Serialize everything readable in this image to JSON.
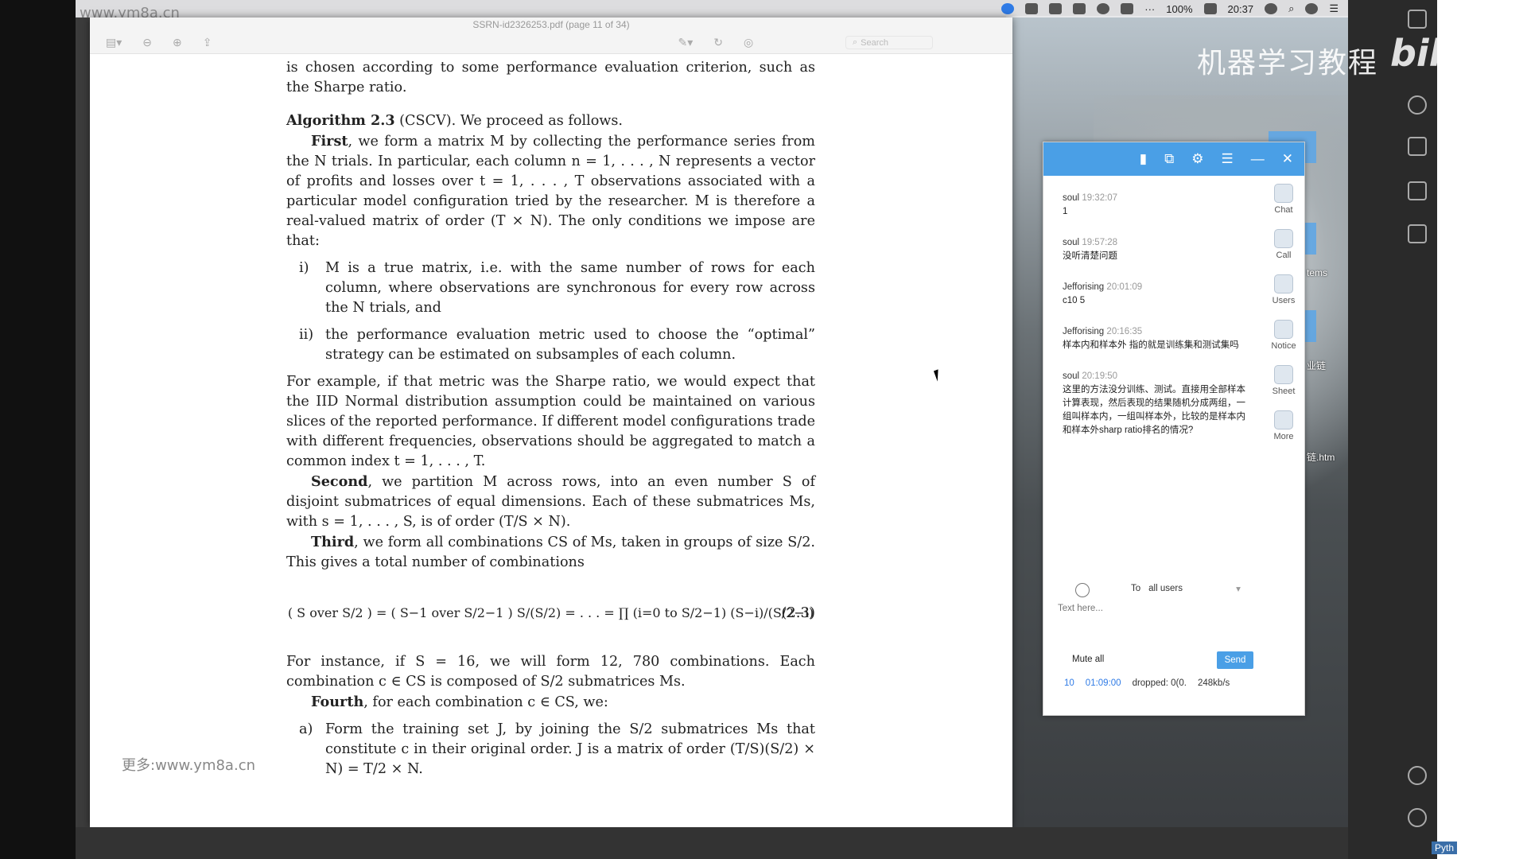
{
  "watermark_top": "www.ym8a.cn",
  "watermark_left": "更多:www.ym8a.cn",
  "menubar": {
    "battery": "100%",
    "time": "20:37"
  },
  "pdf": {
    "window_title": "SSRN-id2326253.pdf (page 11 of 34)",
    "search_placeholder": "Search",
    "lines": {
      "p0": "is chosen according to some performance evaluation criterion, such as the Sharpe ratio.",
      "alg_head": "Algorithm 2.3",
      "alg_tail": " (CSCV). We proceed as follows.",
      "first_bold": "First",
      "first_text": ", we form a matrix M by collecting the performance series from the N trials. In particular, each column n = 1, . . . , N represents a vector of profits and losses over t = 1, . . . , T observations associated with a particular model configuration tried by the researcher. M is therefore a real-valued matrix of order (T × N). The only conditions we impose are that:",
      "item1_mark": "i)",
      "item1": "M is a true matrix, i.e. with the same number of rows for each column, where observations are synchronous for every row across the N trials, and",
      "item2_mark": "ii)",
      "item2": "the performance evaluation metric used to choose the “optimal” strategy can be estimated on subsamples of each column.",
      "p_example": "For example, if that metric was the Sharpe ratio, we would expect that the IID Normal distribution assumption could be maintained on various slices of the reported performance. If different model configurations trade with different frequencies, observations should be aggregated to match a common index t = 1, . . . , T.",
      "second_bold": "Second",
      "second_text": ", we partition M across rows, into an even number S of disjoint submatrices of equal dimensions. Each of these submatrices Ms, with s = 1, . . . , S, is of order (T/S × N).",
      "third_bold": "Third",
      "third_text": ", we form all combinations CS of Ms, taken in groups of size S/2. This gives a total number of combinations",
      "equation": "( S over S/2 ) = ( S−1 over S/2−1 ) S/(S/2) = . . . = ∏ (i=0 to S/2−1) (S−i)/(S/2−i)",
      "eq_number": "(2.3)",
      "p_instance": "For instance, if S = 16, we will form 12, 780 combinations. Each combination c ∈ CS is composed of S/2 submatrices Ms.",
      "fourth_bold": "Fourth",
      "fourth_text": ", for each combination c ∈ CS, we:",
      "itema_mark": "a)",
      "itema": "Form the training set J, by joining the S/2 submatrices Ms that constitute c in their original order. J is a matrix of order (T/S)(S/2) × N) = T/2 × N."
    }
  },
  "chat": {
    "messages": [
      {
        "user": "soul",
        "time": "19:32:07",
        "text": "1"
      },
      {
        "user": "soul",
        "time": "19:57:28",
        "text": "没听清楚问题"
      },
      {
        "user": "Jefforising",
        "time": "20:01:09",
        "text": "c10 5"
      },
      {
        "user": "Jefforising",
        "time": "20:16:35",
        "text": "样本内和样本外 指的就是训练集和测试集吗"
      },
      {
        "user": "soul",
        "time": "20:19:50",
        "text": "这里的方法没分训练、测试。直接用全部样本计算表现，然后表现的结果随机分成两组，一组叫样本内，一组叫样本外，比较的是样本内和样本外sharp ratio排名的情况?"
      }
    ],
    "side": [
      "Chat",
      "Call",
      "Users",
      "Notice",
      "Sheet",
      "More"
    ],
    "to_label": "To",
    "to_value": "all users",
    "input_placeholder": "Text here...",
    "mute_label": "Mute all",
    "send_label": "Send",
    "status": {
      "count": "10",
      "elapsed": "01:09:00",
      "dropped": "dropped: 0(0.",
      "rate": "248kb/s"
    }
  },
  "desktop": {
    "label1": "tems",
    "label2": "业链",
    "label3": "链.htm",
    "cn_title": "机器学习教程",
    "brand": "bilibili",
    "pyth": "Pyth"
  }
}
